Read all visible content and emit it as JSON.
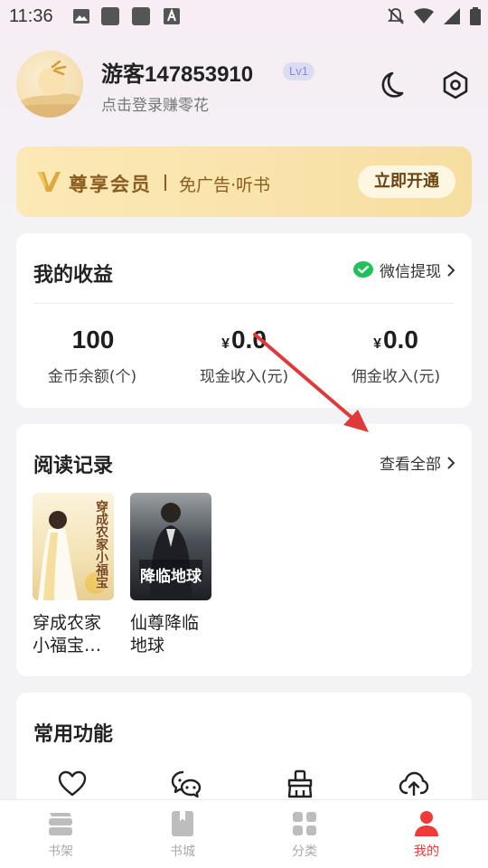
{
  "status_bar": {
    "time": "11:36"
  },
  "profile": {
    "username": "游客147853910",
    "level": "Lv1",
    "login_hint": "点击登录赚零花"
  },
  "vip": {
    "title": "尊享会员",
    "subtitle": "免广告·听书",
    "button": "立即开通"
  },
  "earnings": {
    "title": "我的收益",
    "wechat_withdraw": "微信提现",
    "stats": [
      {
        "value": "100",
        "currency": "",
        "label": "金币余额(个)"
      },
      {
        "value": "0.0",
        "currency": "¥",
        "label": "现金收入(元)"
      },
      {
        "value": "0.0",
        "currency": "¥",
        "label": "佣金收入(元)"
      }
    ]
  },
  "history": {
    "title": "阅读记录",
    "see_all": "查看全部",
    "books": [
      {
        "title": "穿成农家小福宝…",
        "cover_text": "穿成农家小福宝"
      },
      {
        "title": "仙尊降临地球",
        "cover_text": "降临地球"
      }
    ]
  },
  "functions": {
    "title": "常用功能",
    "icons": [
      "heart-icon",
      "chat-icon",
      "broom-icon",
      "cloud-upload-icon"
    ]
  },
  "tabs": [
    {
      "label": "书架",
      "icon": "bookshelf-icon",
      "active": false
    },
    {
      "label": "书城",
      "icon": "bookstore-icon",
      "active": false
    },
    {
      "label": "分类",
      "icon": "category-icon",
      "active": false
    },
    {
      "label": "我的",
      "icon": "profile-icon",
      "active": true
    }
  ],
  "colors": {
    "accent": "#f03a3a",
    "vip_gold": "#8a5c20",
    "wechat_green": "#20c05c",
    "annotation_arrow": "#e0393a"
  }
}
